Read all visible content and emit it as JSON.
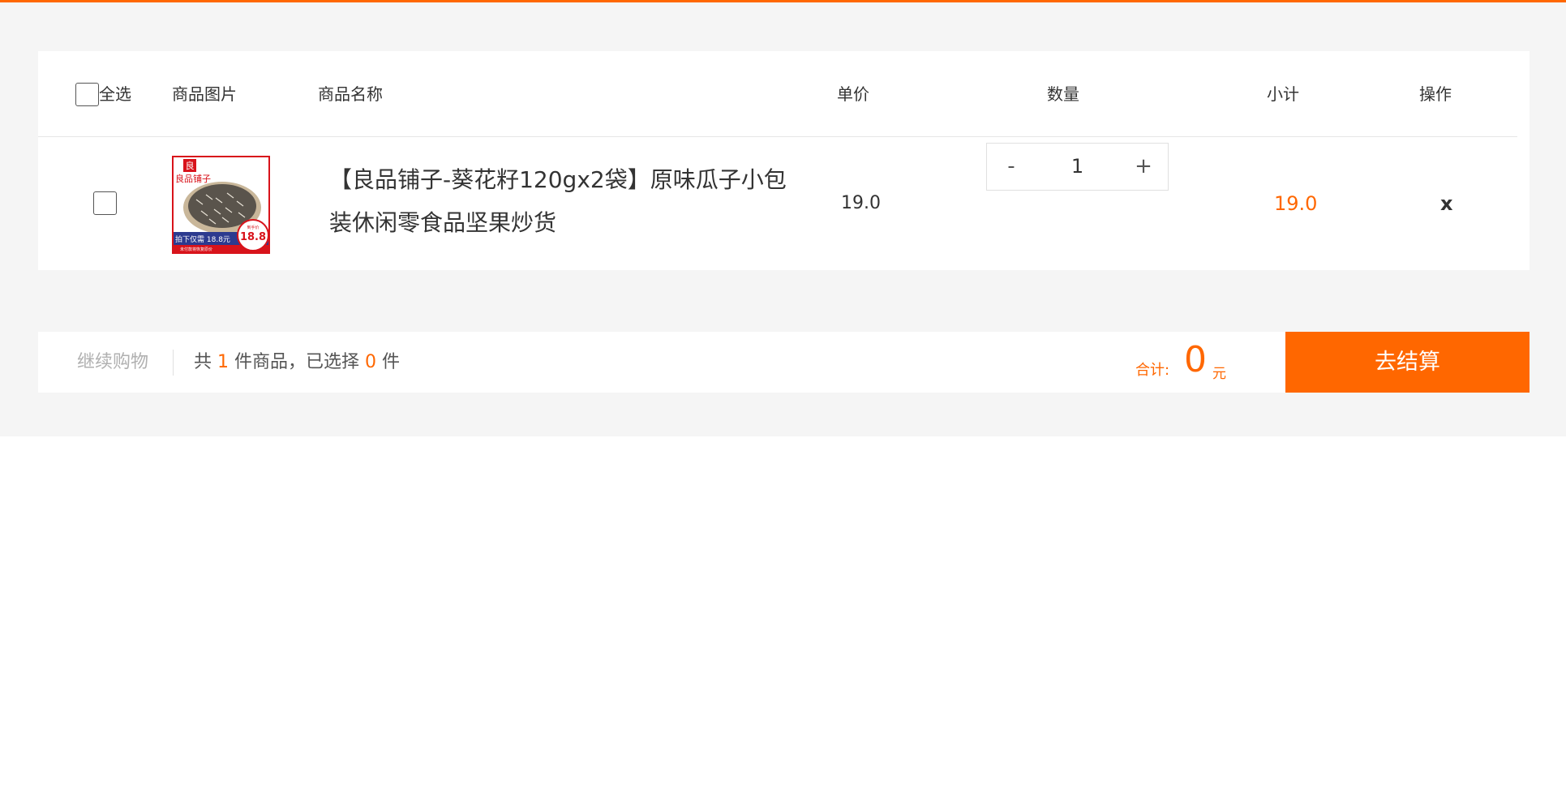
{
  "header": {
    "select_all": "全选",
    "col_image": "商品图片",
    "col_name": "商品名称",
    "col_price": "单价",
    "col_qty": "数量",
    "col_subtotal": "小计",
    "col_action": "操作"
  },
  "item": {
    "name": "【良品铺子-葵花籽120gx2袋】原味瓜子小包装休闲零食品坚果炒货",
    "price": "19.0",
    "qty": "1",
    "minus": "-",
    "plus": "+",
    "subtotal": "19.0",
    "remove": "x",
    "image": {
      "logo_char": "良",
      "brand": "良品铺子",
      "promo": "拍下仅需",
      "promo_price": "18.8元",
      "badge_small": "到手价",
      "badge_price": "18.8",
      "footnote": "未付款将恢复原价"
    }
  },
  "footer": {
    "continue": "继续购物",
    "count_prefix": "共",
    "count_total": "1",
    "count_middle": "件商品，已选择",
    "count_selected": "0",
    "count_suffix": "件",
    "total_label": "合计:",
    "total_value": "0",
    "total_unit": "元",
    "checkout": "去结算"
  },
  "colors": {
    "accent": "#ff6700",
    "background": "#f5f5f5"
  }
}
